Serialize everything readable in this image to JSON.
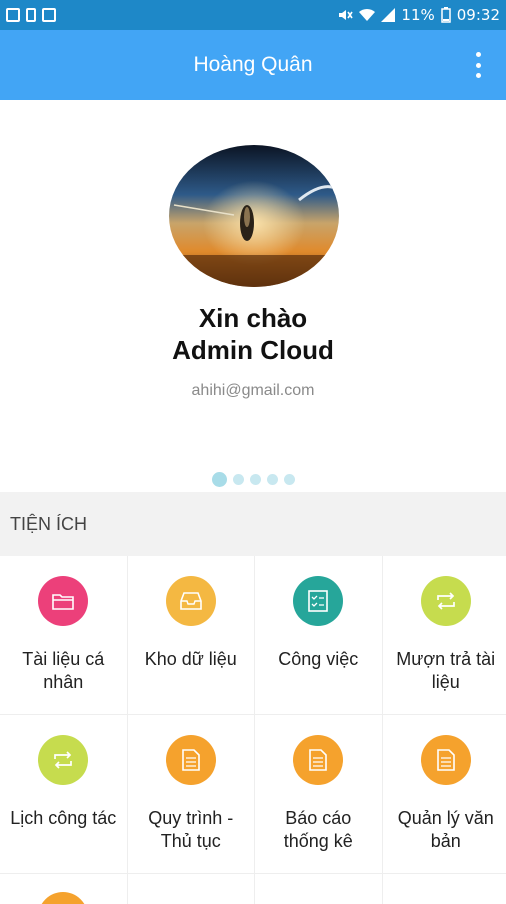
{
  "status": {
    "battery": "11%",
    "time": "09:32"
  },
  "appbar": {
    "title": "Hoàng Quân"
  },
  "profile": {
    "greeting_line1": "Xin chào",
    "greeting_line2": "Admin Cloud",
    "email": "ahihi@gmail.com",
    "page_dots": 5,
    "active_dot": 1
  },
  "section": {
    "title": "TIỆN ÍCH"
  },
  "tiles": [
    {
      "label": "Tài liệu cá nhân",
      "icon": "folder-icon",
      "color": "#ec407a"
    },
    {
      "label": "Kho dữ liệu",
      "icon": "inbox-icon",
      "color": "#f4b842"
    },
    {
      "label": "Công việc",
      "icon": "checklist-icon",
      "color": "#26a69a"
    },
    {
      "label": "Mượn trả tài liệu",
      "icon": "swap-icon",
      "color": "#c6dc4e"
    },
    {
      "label": "Lịch công tác",
      "icon": "swap-icon",
      "color": "#c6dc4e"
    },
    {
      "label": "Quy trình - Thủ tục",
      "icon": "document-icon",
      "color": "#f5a22d"
    },
    {
      "label": "Báo cáo thống kê",
      "icon": "document-icon",
      "color": "#f5a22d"
    },
    {
      "label": "Quản lý văn bản",
      "icon": "document-icon",
      "color": "#f5a22d"
    }
  ],
  "colors": {
    "statusbar": "#1e88c8",
    "appbar": "#42a5f5"
  }
}
